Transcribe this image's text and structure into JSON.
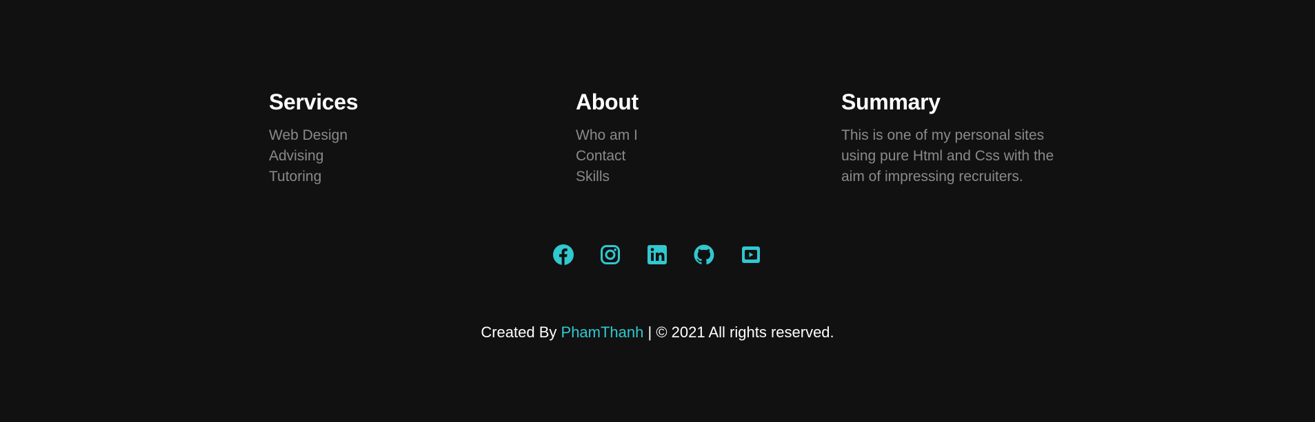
{
  "services": {
    "title": "Services",
    "items": [
      "Web Design",
      "Advising",
      "Tutoring"
    ]
  },
  "about": {
    "title": "About",
    "items": [
      "Who am I",
      "Contact",
      "Skills"
    ]
  },
  "summary": {
    "title": "Summary",
    "text": "This is one of my personal sites using pure Html and Css with the aim of impressing recruiters."
  },
  "social": {
    "icons": [
      "facebook-icon",
      "instagram-icon",
      "linkedin-icon",
      "github-icon",
      "youtube-icon"
    ],
    "color": "#31c8d0"
  },
  "copyright": {
    "prefix": "Created By ",
    "author": "PhamThanh",
    "suffix": " | © 2021 All rights reserved."
  },
  "colors": {
    "background": "#111111",
    "heading": "#ffffff",
    "muted_text": "#8a8a8a",
    "accent": "#31c8d0"
  }
}
